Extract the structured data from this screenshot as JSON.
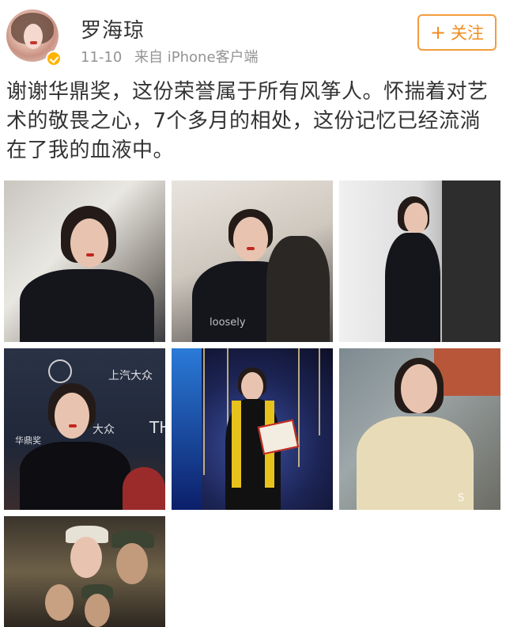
{
  "header": {
    "username": "罗海琼",
    "date": "11-10",
    "source": "来自 iPhone客户端",
    "follow_label": "关注",
    "follow_icon": "plus-icon",
    "avatar_badge": "verified-badge-icon",
    "accent_color": "#f28b20"
  },
  "post": {
    "text": "谢谢华鼎奖，这份荣誉属于所有风筝人。怀揣着对艺术的敬畏之心，7个多月的相处，这份记忆已经流淌在了我的血液中。"
  },
  "photos": {
    "p2_tag": "loosely",
    "p4_logo_1": "上汽大众",
    "p4_logo_2": "华鼎奖",
    "p4_logo_3": "大众",
    "p4_logo_4": "TH",
    "p6_watermark": "S"
  }
}
